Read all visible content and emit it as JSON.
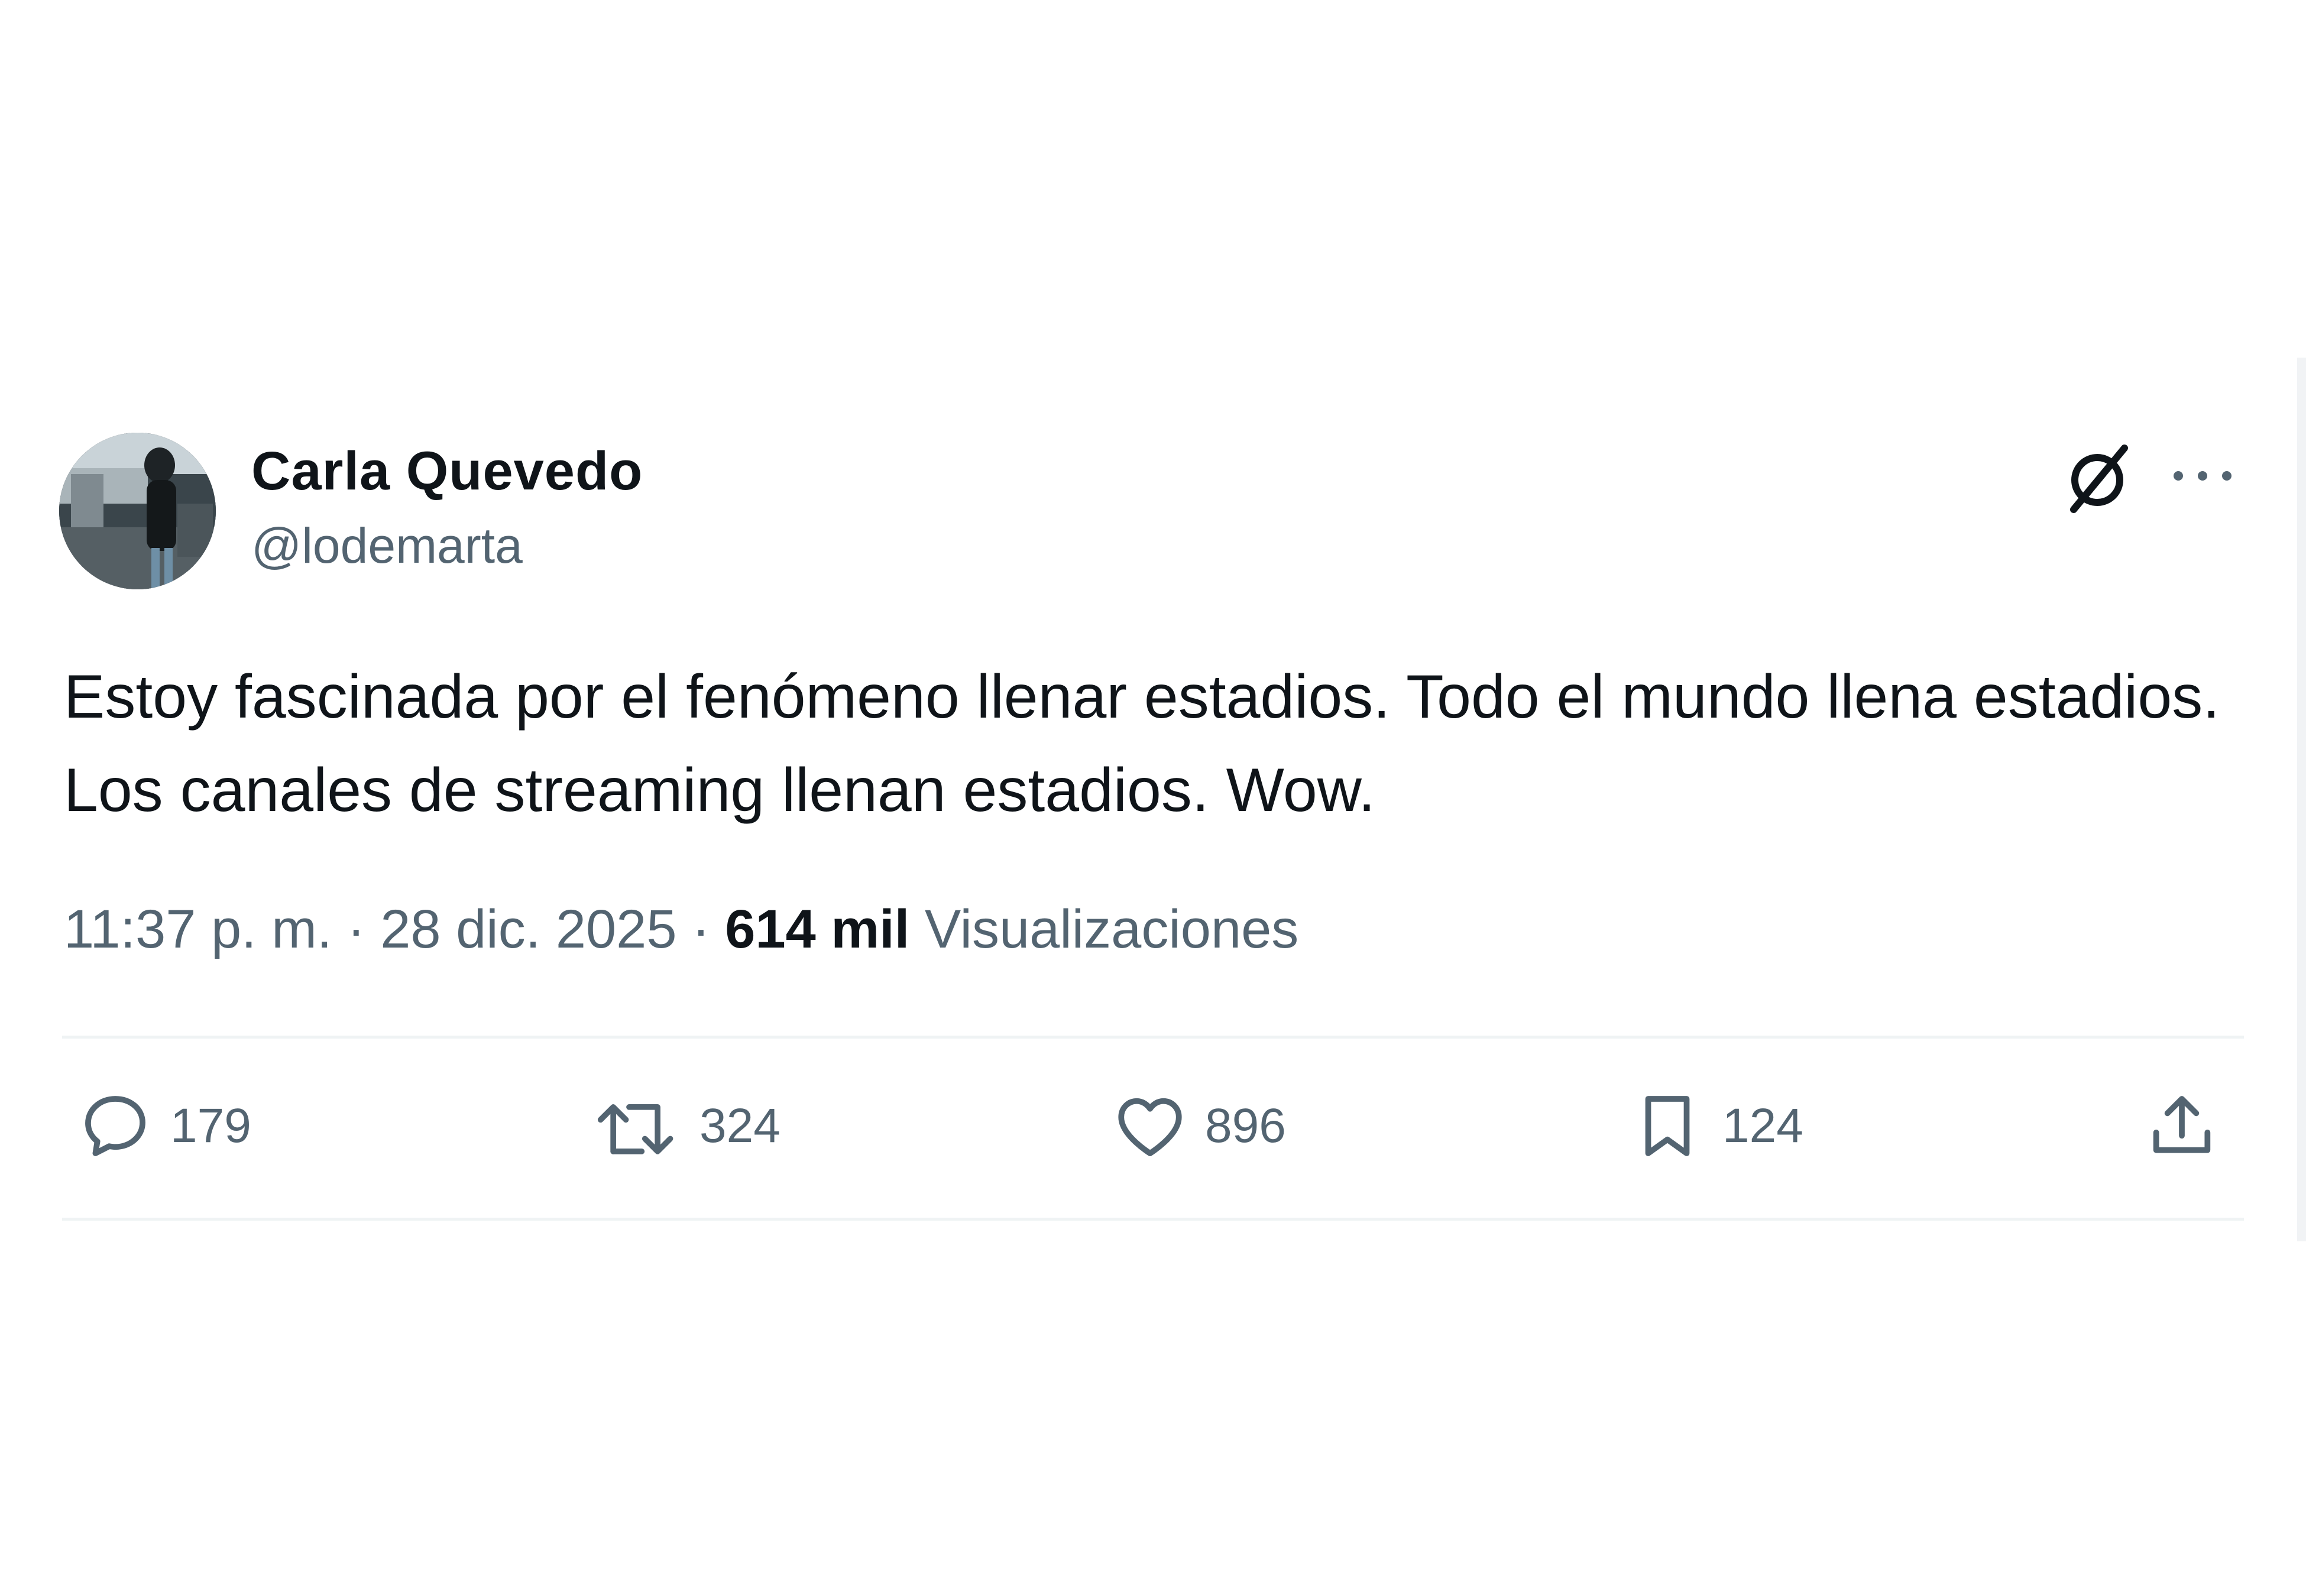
{
  "tweet": {
    "author_name": "Carla Quevedo",
    "author_handle": "@lodemarta",
    "text": "Estoy fascinada por el fenómeno llenar estadios. Todo el mundo llena estadios. Los canales de streaming llenan estadios. Wow.",
    "time": "11:37 p. m.",
    "separator": " · ",
    "date": "28 dic. 2025",
    "views_count": "614 mil",
    "views_label": "Visualizaciones"
  },
  "actions": {
    "replies": "179",
    "retweets": "324",
    "likes": "896",
    "bookmarks": "124"
  },
  "icons": {
    "avatar": "avatar-photo",
    "grok": "grok-icon",
    "more": "more-icon",
    "reply": "reply-icon",
    "retweet": "retweet-icon",
    "like": "heart-icon",
    "bookmark": "bookmark-icon",
    "share": "share-icon"
  },
  "colors": {
    "text_primary": "#0f1419",
    "text_secondary": "#536471",
    "divider": "#eff3f4"
  }
}
